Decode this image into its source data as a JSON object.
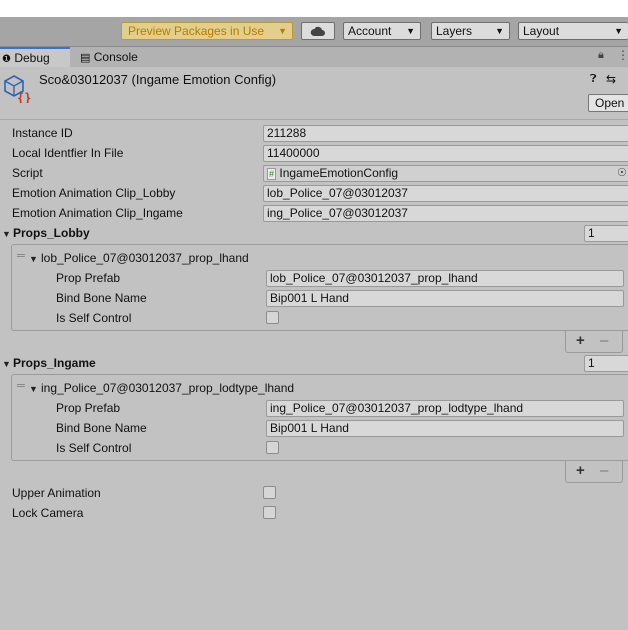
{
  "toolbar": {
    "preview_packages": "Preview Packages in Use",
    "account": "Account",
    "layers": "Layers",
    "layout": "Layout"
  },
  "tabs": {
    "debug": "Debug",
    "console": "Console"
  },
  "header": {
    "title": "Sco&03012037 (Ingame Emotion Config)",
    "open_button": "Open"
  },
  "fields": {
    "instance_id": {
      "label": "Instance ID",
      "value": "211288"
    },
    "local_identifier": {
      "label": "Local Identfier In File",
      "value": "11400000"
    },
    "script": {
      "label": "Script",
      "value": "IngameEmotionConfig"
    },
    "clip_lobby": {
      "label": "Emotion Animation Clip_Lobby",
      "value": "lob_Police_07@03012037"
    },
    "clip_ingame": {
      "label": "Emotion Animation Clip_Ingame",
      "value": "ing_Police_07@03012037"
    }
  },
  "props_lobby": {
    "label": "Props_Lobby",
    "count": "1",
    "element": {
      "name": "lob_Police_07@03012037_prop_lhand",
      "prop_prefab_label": "Prop Prefab",
      "prop_prefab_value": "lob_Police_07@03012037_prop_lhand",
      "bind_bone_label": "Bind Bone Name",
      "bind_bone_value": "Bip001 L Hand",
      "self_control_label": "Is Self Control"
    }
  },
  "props_ingame": {
    "label": "Props_Ingame",
    "count": "1",
    "element": {
      "name": "ing_Police_07@03012037_prop_lodtype_lhand",
      "prop_prefab_label": "Prop Prefab",
      "prop_prefab_value": "ing_Police_07@03012037_prop_lodtype_lhand",
      "bind_bone_label": "Bind Bone Name",
      "bind_bone_value": "Bip001 L Hand",
      "self_control_label": "Is Self Control"
    }
  },
  "upper_animation": {
    "label": "Upper Animation"
  },
  "lock_camera": {
    "label": "Lock Camera"
  },
  "colors": {
    "background": "#c2c2c2",
    "toolbar": "#a5a5a5",
    "preview_text": "#b57c00",
    "tab_accent": "#3a72c9"
  }
}
